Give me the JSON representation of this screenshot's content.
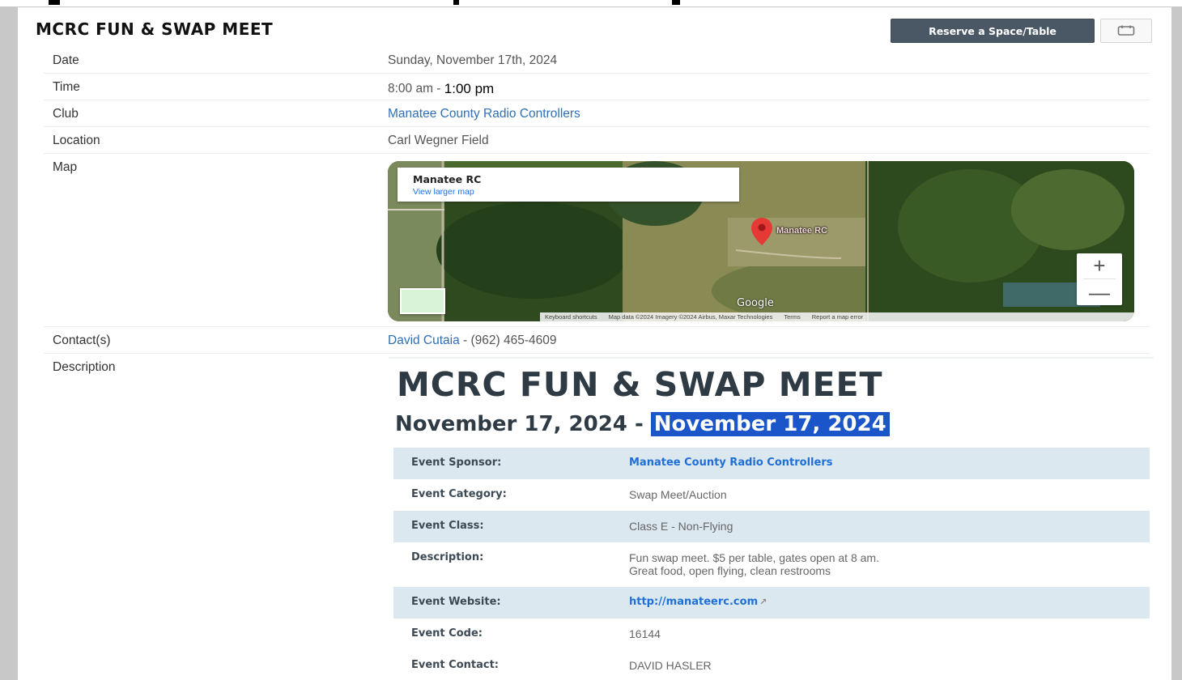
{
  "event": {
    "title": "MCRC FUN & SWAP MEET",
    "reserve_label": "Reserve a Space/Table",
    "calendar_icon": "calendar-icon"
  },
  "details": {
    "date_label": "Date",
    "date_value": "Sunday, November 17th, 2024",
    "time_label": "Time",
    "time_start": "8:00 am - ",
    "time_end": "1:00 pm",
    "club_label": "Club",
    "club_value": "Manatee County Radio Controllers",
    "location_label": "Location",
    "location_value": "Carl Wegner Field",
    "map_label": "Map",
    "contacts_label": "Contact(s)",
    "contact_name": "David Cutaia",
    "contact_phone": " - (962) 465-4609",
    "description_label": "Description"
  },
  "map": {
    "place_name": "Manatee RC",
    "larger_map_link": "View larger map",
    "pin_label": "Manatee RC",
    "zoom_in": "+",
    "zoom_out": "—",
    "provider": "Google",
    "attribution": {
      "shortcuts": "Keyboard shortcuts",
      "data": "Map data ©2024 Imagery ©2024 Airbus, Maxar Technologies",
      "terms": "Terms",
      "report": "Report a map error"
    }
  },
  "description": {
    "heading": "MCRC FUN & SWAP MEET",
    "date_start": "November 17, 2024 - ",
    "date_end": "November 17, 2024",
    "rows": [
      {
        "key": "Event Sponsor:",
        "value": "Manatee County Radio Controllers"
      },
      {
        "key": "Event Category:",
        "value": "Swap Meet/Auction"
      },
      {
        "key": "Event Class:",
        "value": "Class E - Non-Flying"
      },
      {
        "key": "Description:",
        "value_line1": "Fun swap meet. $5 per table, gates open at 8 am.",
        "value_line2": "Great food, open flying, clean restrooms"
      },
      {
        "key": "Event Website:",
        "value": "http://manateerc.com"
      },
      {
        "key": "Event Code:",
        "value": "16144"
      },
      {
        "key": "Event Contact:",
        "value": "DAVID HASLER"
      }
    ]
  },
  "colors": {
    "button_bg": "#4a5866",
    "link": "#2f6fb5",
    "highlight": "#1a55c9",
    "alt_row": "#dce8f0"
  }
}
